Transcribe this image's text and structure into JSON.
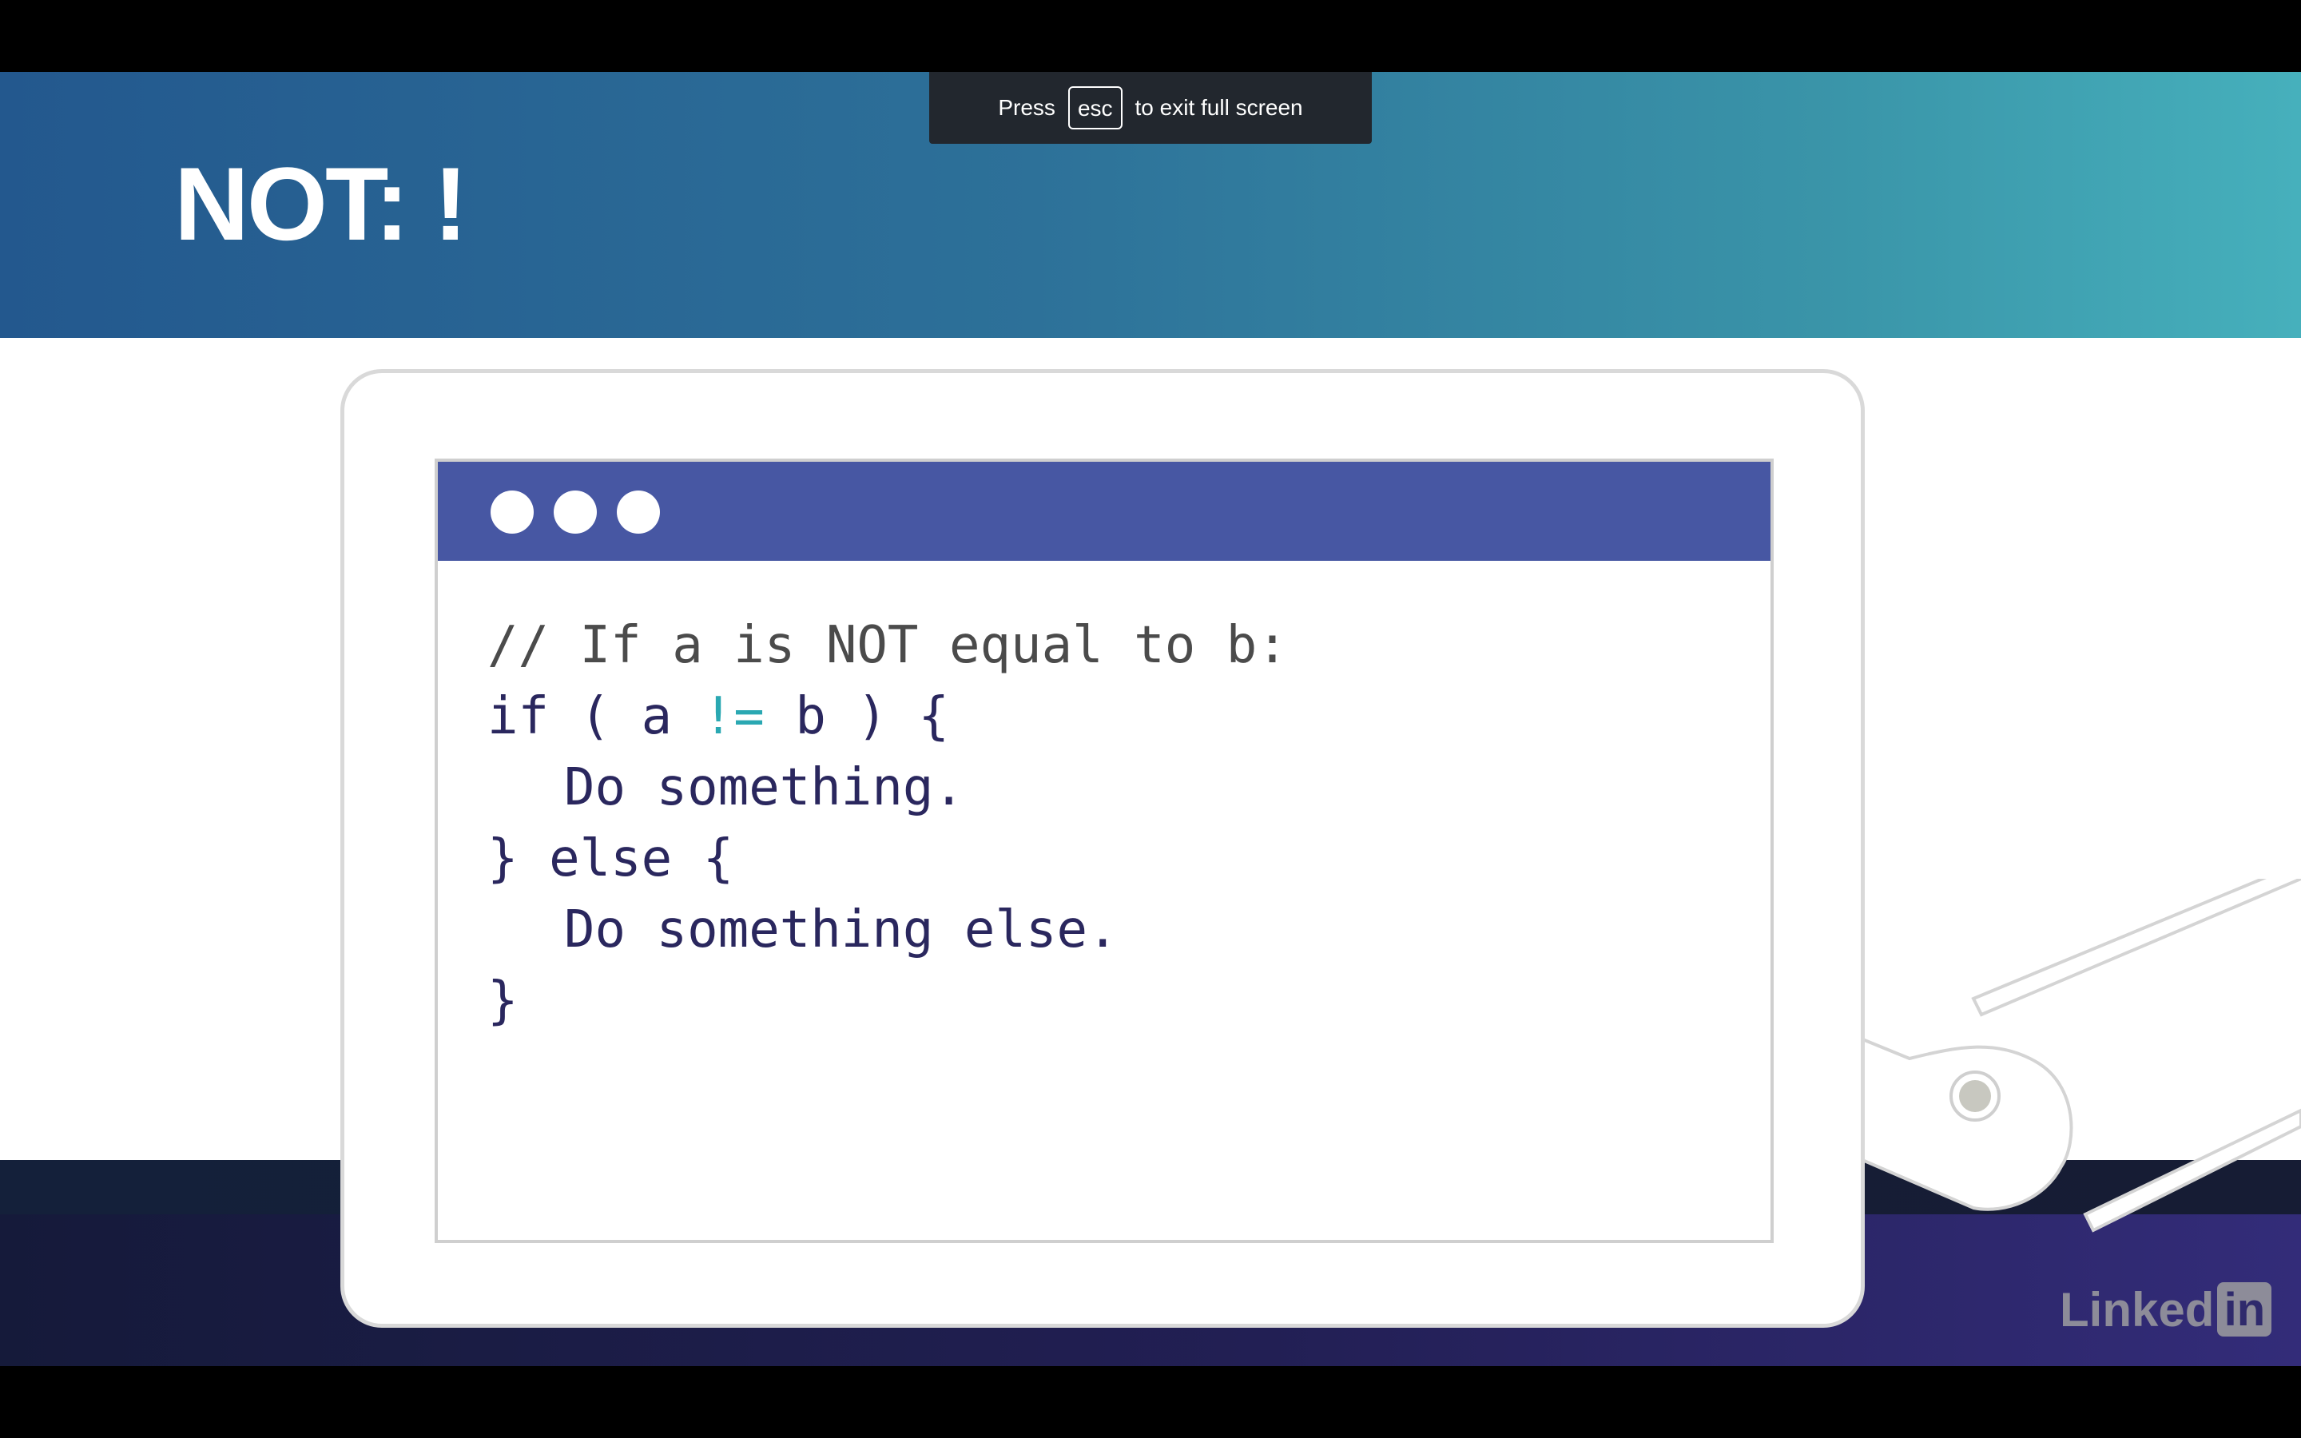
{
  "toast": {
    "prefix": "Press",
    "key": "esc",
    "suffix": "to exit full screen"
  },
  "slide": {
    "title": "NOT: !",
    "code": {
      "comment": "// If a is NOT equal to b:",
      "if_open": "if ( a ",
      "operator": "!=",
      "if_close": " b ) {",
      "action": "Do something.",
      "else_line": "} else {",
      "else_action": "Do something else.",
      "closing": "}"
    }
  },
  "watermark": {
    "text": "Linked",
    "box": "in"
  },
  "colors": {
    "title_bar": "#4757a3",
    "operator": "#2aa8b2",
    "code_text": "#2a275e",
    "banner_start": "#23588e",
    "banner_end": "#46b0bc"
  }
}
